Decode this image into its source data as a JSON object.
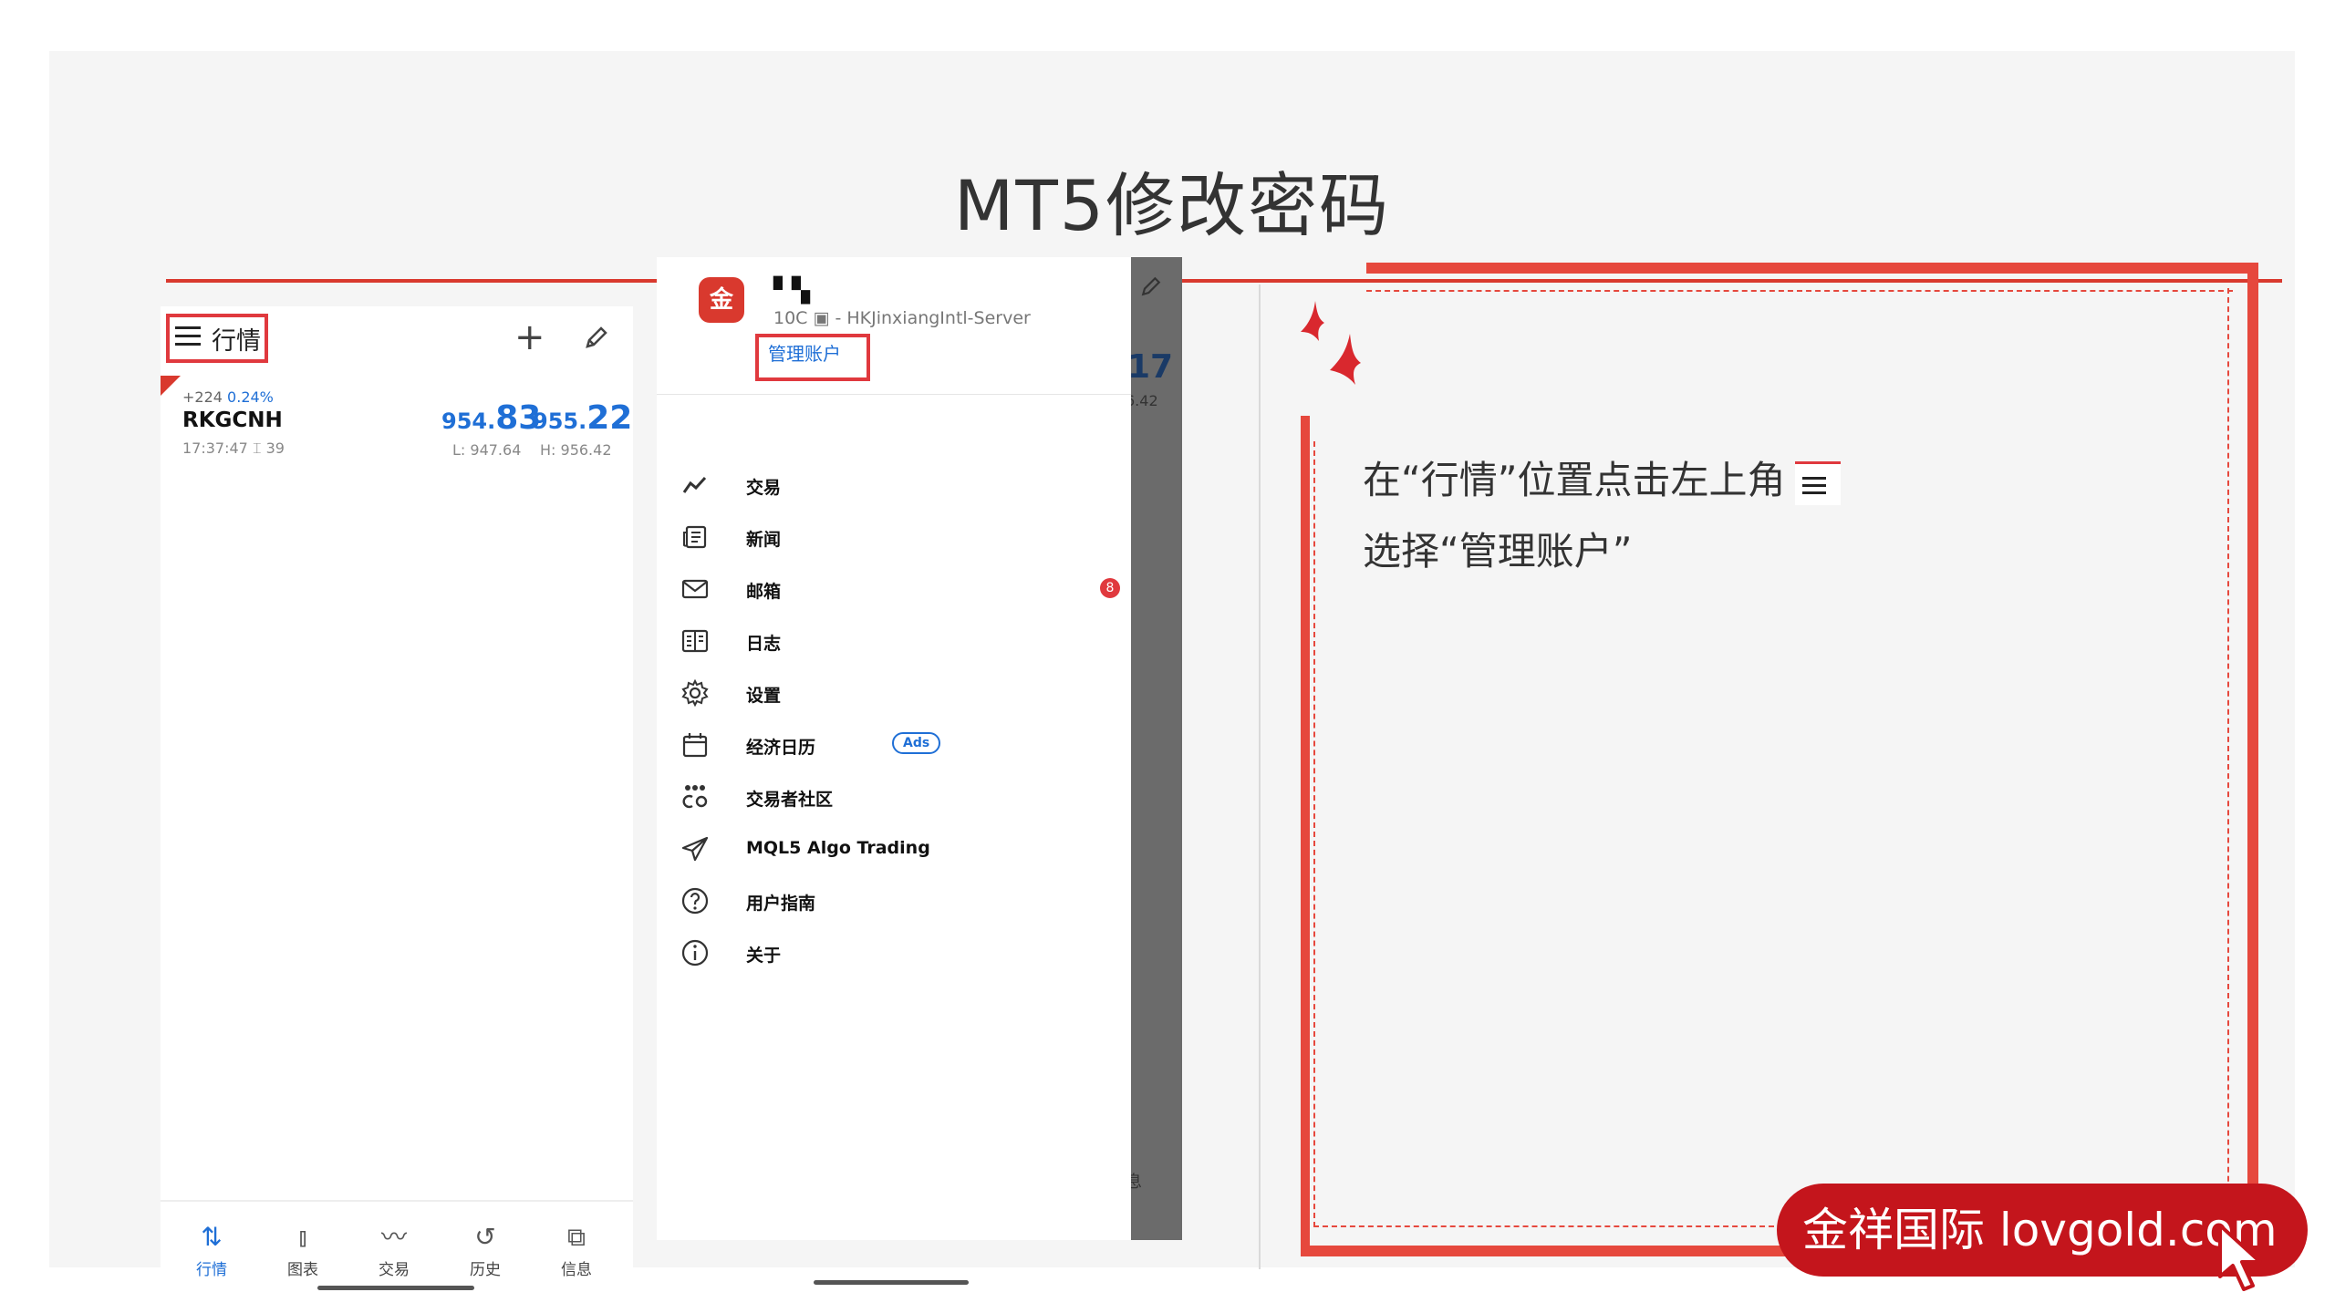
{
  "slide": {
    "title": "MT5修改密码"
  },
  "phone1": {
    "header_title": "行情",
    "quote": {
      "change": "+224",
      "change_pct": "0.24%",
      "symbol": "RKGCNH",
      "time": "17:37:47 ⌶ 39",
      "bid_small": "954.",
      "bid_big": "83",
      "ask_small": "955.",
      "ask_big": "22",
      "low": "L: 947.64",
      "high": "H: 956.42"
    },
    "nav": [
      {
        "label": "行情",
        "icon": "quotes-icon",
        "active": true
      },
      {
        "label": "图表",
        "icon": "chart-icon"
      },
      {
        "label": "交易",
        "icon": "trade-icon"
      },
      {
        "label": "历史",
        "icon": "history-icon"
      },
      {
        "label": "信息",
        "icon": "messages-icon"
      }
    ]
  },
  "phone2": {
    "logo_text": "金祥",
    "account_name": "▘▚",
    "server": "10C ▣ - HKJinxiangIntl-Server",
    "manage_accounts": "管理账户",
    "menu": [
      {
        "label": "交易",
        "icon": "trade-icon"
      },
      {
        "label": "新闻",
        "icon": "news-icon"
      },
      {
        "label": "邮箱",
        "icon": "mail-icon",
        "badge": "8"
      },
      {
        "label": "日志",
        "icon": "journal-icon"
      },
      {
        "label": "设置",
        "icon": "settings-icon"
      },
      {
        "label": "经济日历",
        "icon": "calendar-icon",
        "tag": "Ads"
      },
      {
        "label": "交易者社区",
        "icon": "community-icon"
      },
      {
        "label": "MQL5 Algo Trading",
        "icon": "send-icon"
      },
      {
        "label": "用户指南",
        "icon": "help-icon"
      },
      {
        "label": "关于",
        "icon": "info-icon"
      }
    ],
    "background_peek": {
      "price": "17",
      "value": "6.42",
      "nav": "息"
    }
  },
  "instructions": {
    "line1": "在“行情”位置点击左上角",
    "line2": "选择“管理账户”"
  },
  "watermark": "金祥国际 lovgold.com",
  "colors": {
    "accent_red": "#e6483d",
    "link_blue": "#1f6fd6",
    "watermark_red": "#c4151c"
  }
}
